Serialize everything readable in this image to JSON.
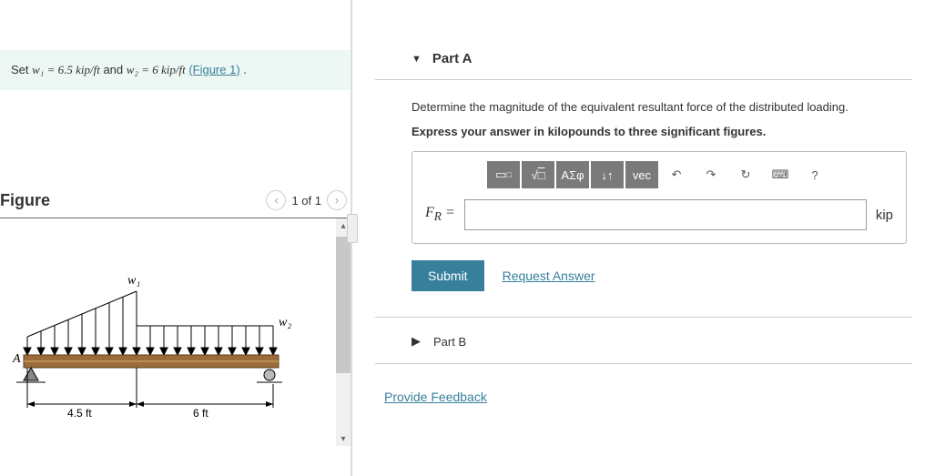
{
  "prompt": {
    "prefix": "Set ",
    "v1": "w₁ = 6.5 kip/ft",
    "mid": " and ",
    "v2": "w₂ = 6 kip/ft",
    "link": "(Figure 1)",
    "suffix": "."
  },
  "figure": {
    "title": "Figure",
    "pager": "1 of 1",
    "labels": {
      "w1": "w₁",
      "w2": "w₂",
      "A": "A",
      "d1": "4.5 ft",
      "d2": "6 ft"
    }
  },
  "partA": {
    "title": "Part A",
    "question": "Determine the magnitude of the equivalent resultant force of the distributed loading.",
    "instruction": "Express your answer in kilopounds to three significant figures.",
    "var_label": "F_R =",
    "unit": "kip",
    "toolbar": {
      "templates": "▭",
      "sqrt": "√",
      "greek": "ΑΣφ",
      "updown": "↓↑",
      "vec": "vec",
      "undo": "↶",
      "redo": "↷",
      "reset": "↻",
      "keyboard": "⌨",
      "help": "?"
    },
    "submit": "Submit",
    "request": "Request Answer"
  },
  "partB": {
    "title": "Part B"
  },
  "feedback": "Provide Feedback",
  "chart_data": {
    "type": "diagram",
    "description": "Beam with distributed loading",
    "w1": 6.5,
    "w2": 6,
    "w_unit": "kip/ft",
    "span1": 4.5,
    "span2": 6,
    "span_unit": "ft",
    "left_support": "pin at A",
    "right_support": "roller"
  }
}
